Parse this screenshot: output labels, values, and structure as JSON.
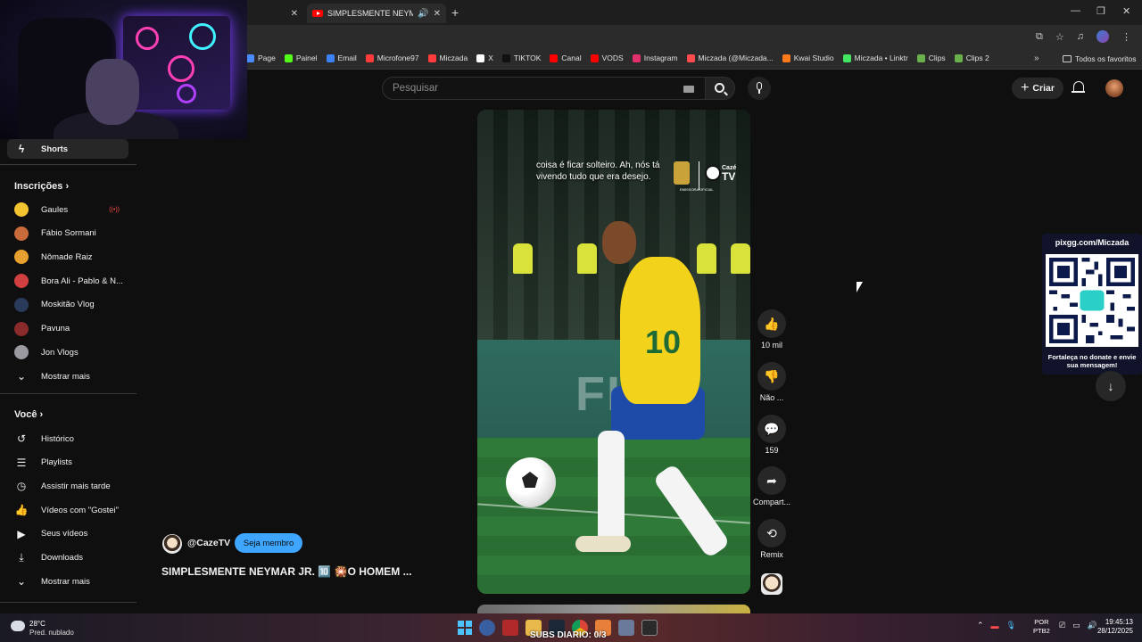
{
  "browser": {
    "tabs": [
      {
        "title": "",
        "active": false
      },
      {
        "title": "SIMPLESMENTE NEYMAR JR.",
        "active": true
      }
    ],
    "bookmarks": [
      {
        "label": "Page",
        "color": "#4a8cff"
      },
      {
        "label": "Painel",
        "color": "#53fc18"
      },
      {
        "label": "Email",
        "color": "#3b82f6"
      },
      {
        "label": "Microfone97",
        "color": "#ff3b3b"
      },
      {
        "label": "Miczada",
        "color": "#ff3b3b"
      },
      {
        "label": "X",
        "color": "#ffffff"
      },
      {
        "label": "TIKTOK",
        "color": "#111111"
      },
      {
        "label": "Canal",
        "color": "#ff0000"
      },
      {
        "label": "VODS",
        "color": "#ff0000"
      },
      {
        "label": "Instagram",
        "color": "#e1306c"
      },
      {
        "label": "Miczada (@Miczada...",
        "color": "#ff4b4b"
      },
      {
        "label": "Kwai Studio",
        "color": "#ff7a1a"
      },
      {
        "label": "Miczada • Linktr",
        "color": "#43e660"
      },
      {
        "label": "Clips",
        "color": "#6ab04c"
      },
      {
        "label": "Clips 2",
        "color": "#6ab04c"
      }
    ],
    "all_bookmarks_label": "Todos os favoritos"
  },
  "header": {
    "search_placeholder": "Pesquisar",
    "create_label": "Criar"
  },
  "sidebar": {
    "shorts_label": "Shorts",
    "subscriptions_title": "Inscrições",
    "channels": [
      {
        "name": "Gaules",
        "color": "#f4c430",
        "live": true
      },
      {
        "name": "Fábio Sormani",
        "color": "#c86a3a",
        "live": false
      },
      {
        "name": "Nômade Raiz",
        "color": "#e8a030",
        "live": false
      },
      {
        "name": "Bora Ali - Pablo & N...",
        "color": "#d04040",
        "live": false
      },
      {
        "name": "Moskitão Vlog",
        "color": "#2a3a5a",
        "live": false
      },
      {
        "name": "Pavuna",
        "color": "#8a2a2a",
        "live": false
      },
      {
        "name": "Jon Vlogs",
        "color": "#9a9aa0",
        "live": false
      }
    ],
    "show_more": "Mostrar mais",
    "you_title": "Você",
    "you_items": [
      {
        "label": "Histórico",
        "icon": "history-icon",
        "glyph": "↺"
      },
      {
        "label": "Playlists",
        "icon": "playlists-icon",
        "glyph": "☰"
      },
      {
        "label": "Assistir mais tarde",
        "icon": "clock-icon",
        "glyph": "◷"
      },
      {
        "label": "Vídeos com \"Gostei\"",
        "icon": "like-icon",
        "glyph": "👍"
      },
      {
        "label": "Seus vídeos",
        "icon": "your-videos-icon",
        "glyph": "▶"
      },
      {
        "label": "Downloads",
        "icon": "download-icon",
        "glyph": "⤓"
      }
    ],
    "show_more_2": "Mostrar mais"
  },
  "short": {
    "caption": "coisa é ficar solteiro. Ah, nós tá vivendo tudo que era desejo.",
    "badge_text": "EMISSORA OFICIAL",
    "caze_small": "Cazé",
    "caze_big": "TV",
    "board_text": "FIFA"
  },
  "actions": {
    "likes": "10 mil",
    "dislike": "Não ...",
    "comments": "159",
    "share": "Compart...",
    "remix": "Remix"
  },
  "channel": {
    "name": "@CazeTV",
    "member_button": "Seja membro",
    "title": "SIMPLESMENTE NEYMAR JR. 🔟 🎇O HOMEM ..."
  },
  "pix_overlay": {
    "url": "pixgg.com/Miczada",
    "footer": "Fortaleça no donate e envie sua mensagem!"
  },
  "taskbar": {
    "temperature": "28°C",
    "weather": "Pred. nublado",
    "subs_text": "SUBS DIARIO: 0/3",
    "lang_line1": "POR",
    "lang_line2": "PTB2",
    "time": "19:45:13",
    "date": "28/12/2025"
  }
}
